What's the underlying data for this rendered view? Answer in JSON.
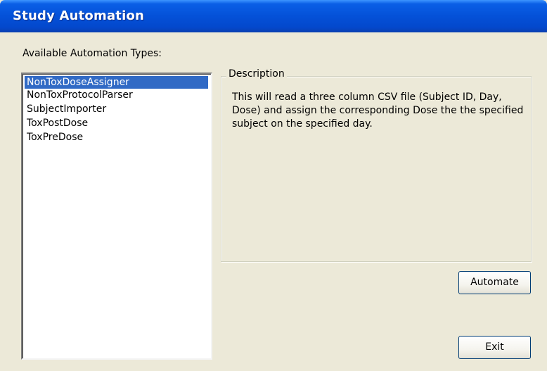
{
  "window": {
    "title": "Study Automation"
  },
  "automation_types": {
    "label": "Available Automation Types:",
    "items": [
      {
        "label": "NonToxDoseAssigner",
        "selected": true
      },
      {
        "label": "NonToxProtocolParser",
        "selected": false
      },
      {
        "label": "SubjectImporter",
        "selected": false
      },
      {
        "label": "ToxPostDose",
        "selected": false
      },
      {
        "label": "ToxPreDose",
        "selected": false
      }
    ]
  },
  "description": {
    "legend": "Description",
    "text": "This will read a three column CSV file (Subject ID, Day, Dose) and assign the corresponding Dose the the specified subject on the specified day."
  },
  "buttons": {
    "automate_label": "Automate",
    "exit_label": "Exit"
  },
  "colors": {
    "titlebar": "#0451d8",
    "selection": "#316ac5",
    "window_bg": "#ece9d8"
  }
}
